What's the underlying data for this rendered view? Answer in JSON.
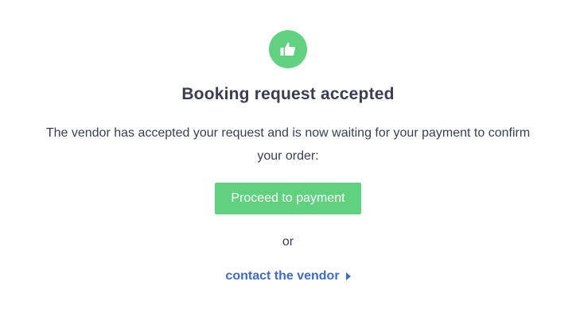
{
  "status_icon": {
    "name": "thumbs-up-icon",
    "color": "#5fd17f"
  },
  "title": "Booking request accepted",
  "message": "The vendor has accepted your request and is now waiting for your payment to confirm your order:",
  "primary_action": {
    "label": "Proceed to payment",
    "color": "#5fd17f"
  },
  "separator": "or",
  "secondary_action": {
    "label": "contact the vendor",
    "icon": "caret-right-icon",
    "color": "#3c68d8"
  }
}
